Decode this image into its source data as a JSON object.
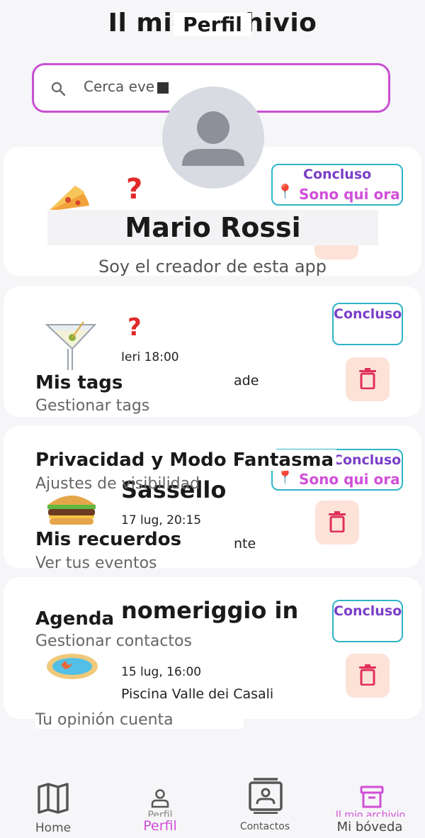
{
  "archive": {
    "title": "Il mio archivio",
    "search_placeholder": "Cerca eve",
    "events": [
      {
        "status": "Concluso",
        "here": "Sono qui ora"
      },
      {
        "status": "Concluso",
        "datetime": "Ieri 18:00",
        "location": "ade"
      },
      {
        "status": "Concluso",
        "here": "Sono qui ora",
        "title": "Sassello",
        "datetime": "17 lug, 20:15",
        "location": "nte"
      },
      {
        "status": "Concluso",
        "title": "nomeriggio in",
        "datetime": "15 lug, 16:00",
        "location": "Piscina Valle dei Casali"
      }
    ]
  },
  "profile": {
    "header": "Perfil",
    "name": "Mario Rossi",
    "bio": "Soy el creador de esta app",
    "menu": [
      {
        "title": "Mis tags",
        "subtitle": "Gestionar tags"
      },
      {
        "title": "Privacidad y Modo Fantasma",
        "subtitle": "Ajustes de visibilidad"
      },
      {
        "title": "Mis recuerdos",
        "subtitle": "Ver tus eventos"
      },
      {
        "title": "Agenda",
        "subtitle": "Gestionar contactos"
      }
    ],
    "footer": "Tu opinión cuenta"
  },
  "nav": {
    "home": "Home",
    "profile_under": "Perfil",
    "profile": "Perfil",
    "contacts": "Contactos",
    "archive_under": "Il mio archivio",
    "vault": "Mi bóveda"
  },
  "colors": {
    "accent": "#c94fd4",
    "status": "#7a3ec8",
    "border_teal": "#2fb4c8",
    "trash_bg": "#fde2d8",
    "trash_icon": "#e0305a"
  }
}
